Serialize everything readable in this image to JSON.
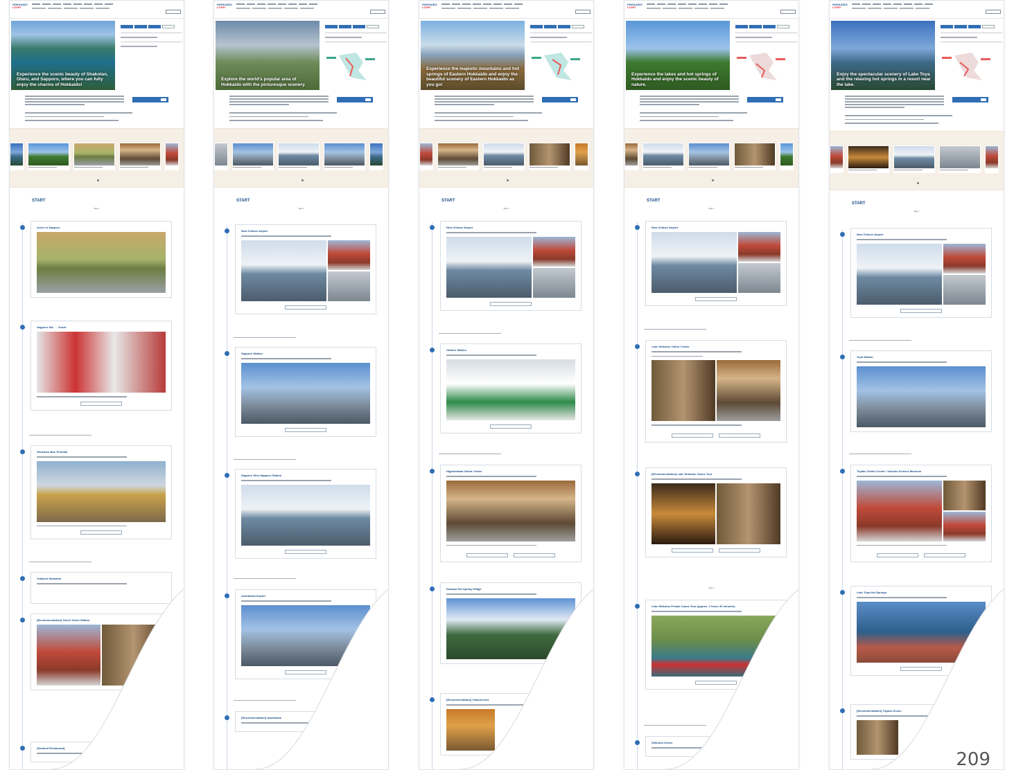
{
  "brand": {
    "line1": "HOKKAIDO",
    "line2": "LOVE!"
  },
  "page_number": "209",
  "panels": [
    {
      "hero_caption": "Experience the scenic beauty of Shakotan, Otaru, and Sapporo, where you can fully enjoy the charms of Hokkaido!",
      "start_label": "START",
      "day_label": "Day 1",
      "stops": [
        {
          "title": "Arrive in Sapporo"
        },
        {
          "title": "Sapporo Sta. → Yoichi"
        },
        {
          "title": "Shukutsu Bus Terminal"
        },
        {
          "title": "Yokaichi Shakotan"
        },
        {
          "title": "[Recommendation] Yoichi Yoichi Station"
        },
        {
          "title": "[Seafood Restaurant]"
        }
      ]
    },
    {
      "hero_caption": "Explore the world's popular area of Hokkaido with the picturesque scenery.",
      "start_label": "START",
      "day_label": "Day 1",
      "stops": [
        {
          "title": "New Chitose Airport"
        },
        {
          "title": "Sapporo Station"
        },
        {
          "title": "Sapporo Shin-Sapporo Station"
        },
        {
          "title": "Asahikawa Airport"
        },
        {
          "title": "[Recommendation] Asahikawa"
        }
      ]
    },
    {
      "hero_caption": "Experience the majestic mountains and hot springs of Eastern Hokkaido and enjoy the beautiful scenery of Eastern Hokkaido as you go!",
      "start_label": "START",
      "day_label": "Day 1",
      "stops": [
        {
          "title": "New Chitose Airport"
        },
        {
          "title": "Obihiro Station"
        },
        {
          "title": "Higashikawa Visitor Center"
        },
        {
          "title": "Kawayu Hot Spring Village"
        },
        {
          "title": "[Recommendation] Tokachi area"
        }
      ]
    },
    {
      "hero_caption": "Experience the lakes and hot springs of Hokkaido and enjoy the scenic beauty of nature.",
      "start_label": "START",
      "day_label": "Day 1",
      "day2_label": "Day 2",
      "stops": [
        {
          "title": "New Chitose Airport"
        },
        {
          "title": "Lake Shikotsu Visitor Center"
        },
        {
          "title": "[Recommendation] Lake Shikotsu Canoe Tour"
        },
        {
          "title": "Lake Shikotsu Private Canoe Tour (approx. 2 hours 30 minutes)"
        },
        {
          "title": "Shikotsu Onsen"
        }
      ]
    },
    {
      "hero_caption": "Enjoy the spectacular scenery of Lake Toya and the relaxing hot springs in a resort near the lake.",
      "start_label": "START",
      "day_label": "Day 1",
      "stops": [
        {
          "title": "New Chitose Airport"
        },
        {
          "title": "Toya Station"
        },
        {
          "title": "Toyako Visitor Center / Volcano Science Museum"
        },
        {
          "title": "Lake Toya Hot Springs"
        },
        {
          "title": "[Recommendation] Toyako Onsen"
        }
      ]
    }
  ]
}
